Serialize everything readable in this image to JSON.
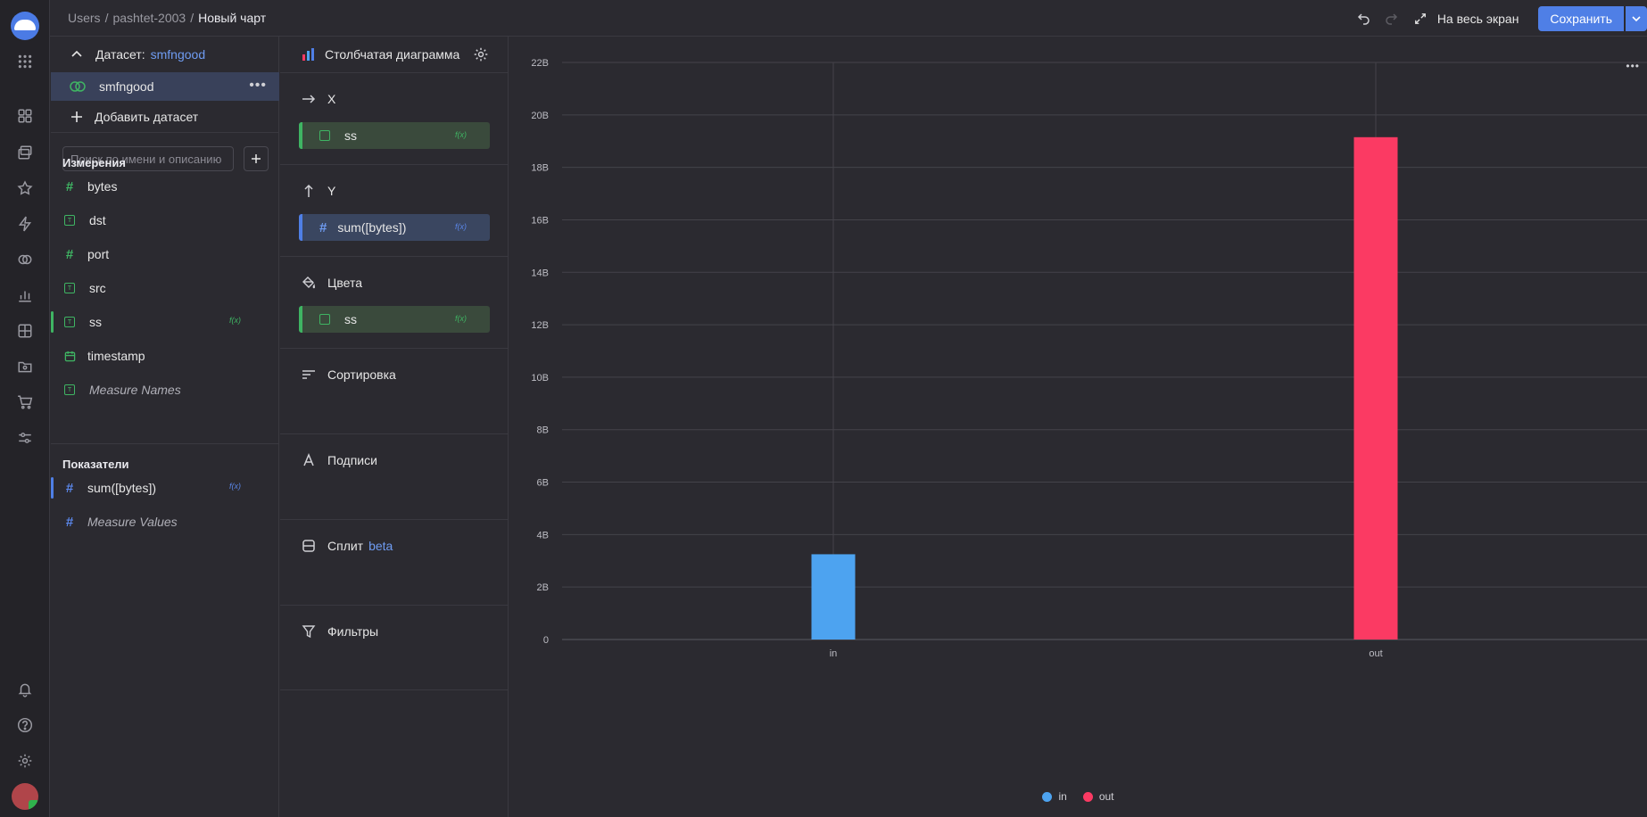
{
  "breadcrumbs": {
    "p1": "Users",
    "p2": "pashtet-2003",
    "current": "Новый чарт",
    "sep": "/"
  },
  "toolbar": {
    "fullscreen": "На весь экран",
    "save": "Сохранить"
  },
  "dataset": {
    "label": "Датасет:",
    "name": "smfngood",
    "row_name": "smfngood",
    "add": "Добавить датасет",
    "search_placeholder": "Поиск по имени и описанию",
    "dimensions_title": "Измерения",
    "dimensions": [
      {
        "name": "bytes",
        "type": "number"
      },
      {
        "name": "dst",
        "type": "text"
      },
      {
        "name": "port",
        "type": "number"
      },
      {
        "name": "src",
        "type": "text"
      },
      {
        "name": "ss",
        "type": "text",
        "formula": "f(x)"
      },
      {
        "name": "timestamp",
        "type": "date"
      },
      {
        "name": "Measure Names",
        "type": "text"
      }
    ],
    "measures_title": "Показатели",
    "measures": [
      {
        "name": "sum([bytes])",
        "formula": "f(x)"
      },
      {
        "name": "Measure Values"
      }
    ]
  },
  "visualization": {
    "type": "Столбчатая диаграмма",
    "sections": {
      "x": {
        "title": "X",
        "chip": "ss",
        "fx": "f(x)"
      },
      "y": {
        "title": "Y",
        "chip": "sum([bytes])",
        "fx": "f(x)"
      },
      "colors": {
        "title": "Цвета",
        "chip": "ss",
        "fx": "f(x)"
      },
      "sort": {
        "title": "Сортировка"
      },
      "labels": {
        "title": "Подписи"
      },
      "split": {
        "title": "Сплит",
        "badge": "beta"
      },
      "filters": {
        "title": "Фильтры"
      }
    }
  },
  "colors": {
    "accent": "#4f7fe6",
    "in": "#4da3f0",
    "out": "#fb3a63",
    "green": "#3fb463"
  },
  "chart_data": {
    "type": "bar",
    "categories": [
      "in",
      "out"
    ],
    "values": [
      3.25,
      19.15
    ],
    "unit": "B",
    "colors": [
      "#4da3f0",
      "#fb3a63"
    ],
    "ylim": [
      0,
      22
    ],
    "yticks": [
      "0",
      "2B",
      "4B",
      "6B",
      "8B",
      "10B",
      "12B",
      "14B",
      "16B",
      "18B",
      "20B",
      "22B"
    ],
    "legend": [
      "in",
      "out"
    ],
    "legend_position": "bottom",
    "grid": true
  }
}
